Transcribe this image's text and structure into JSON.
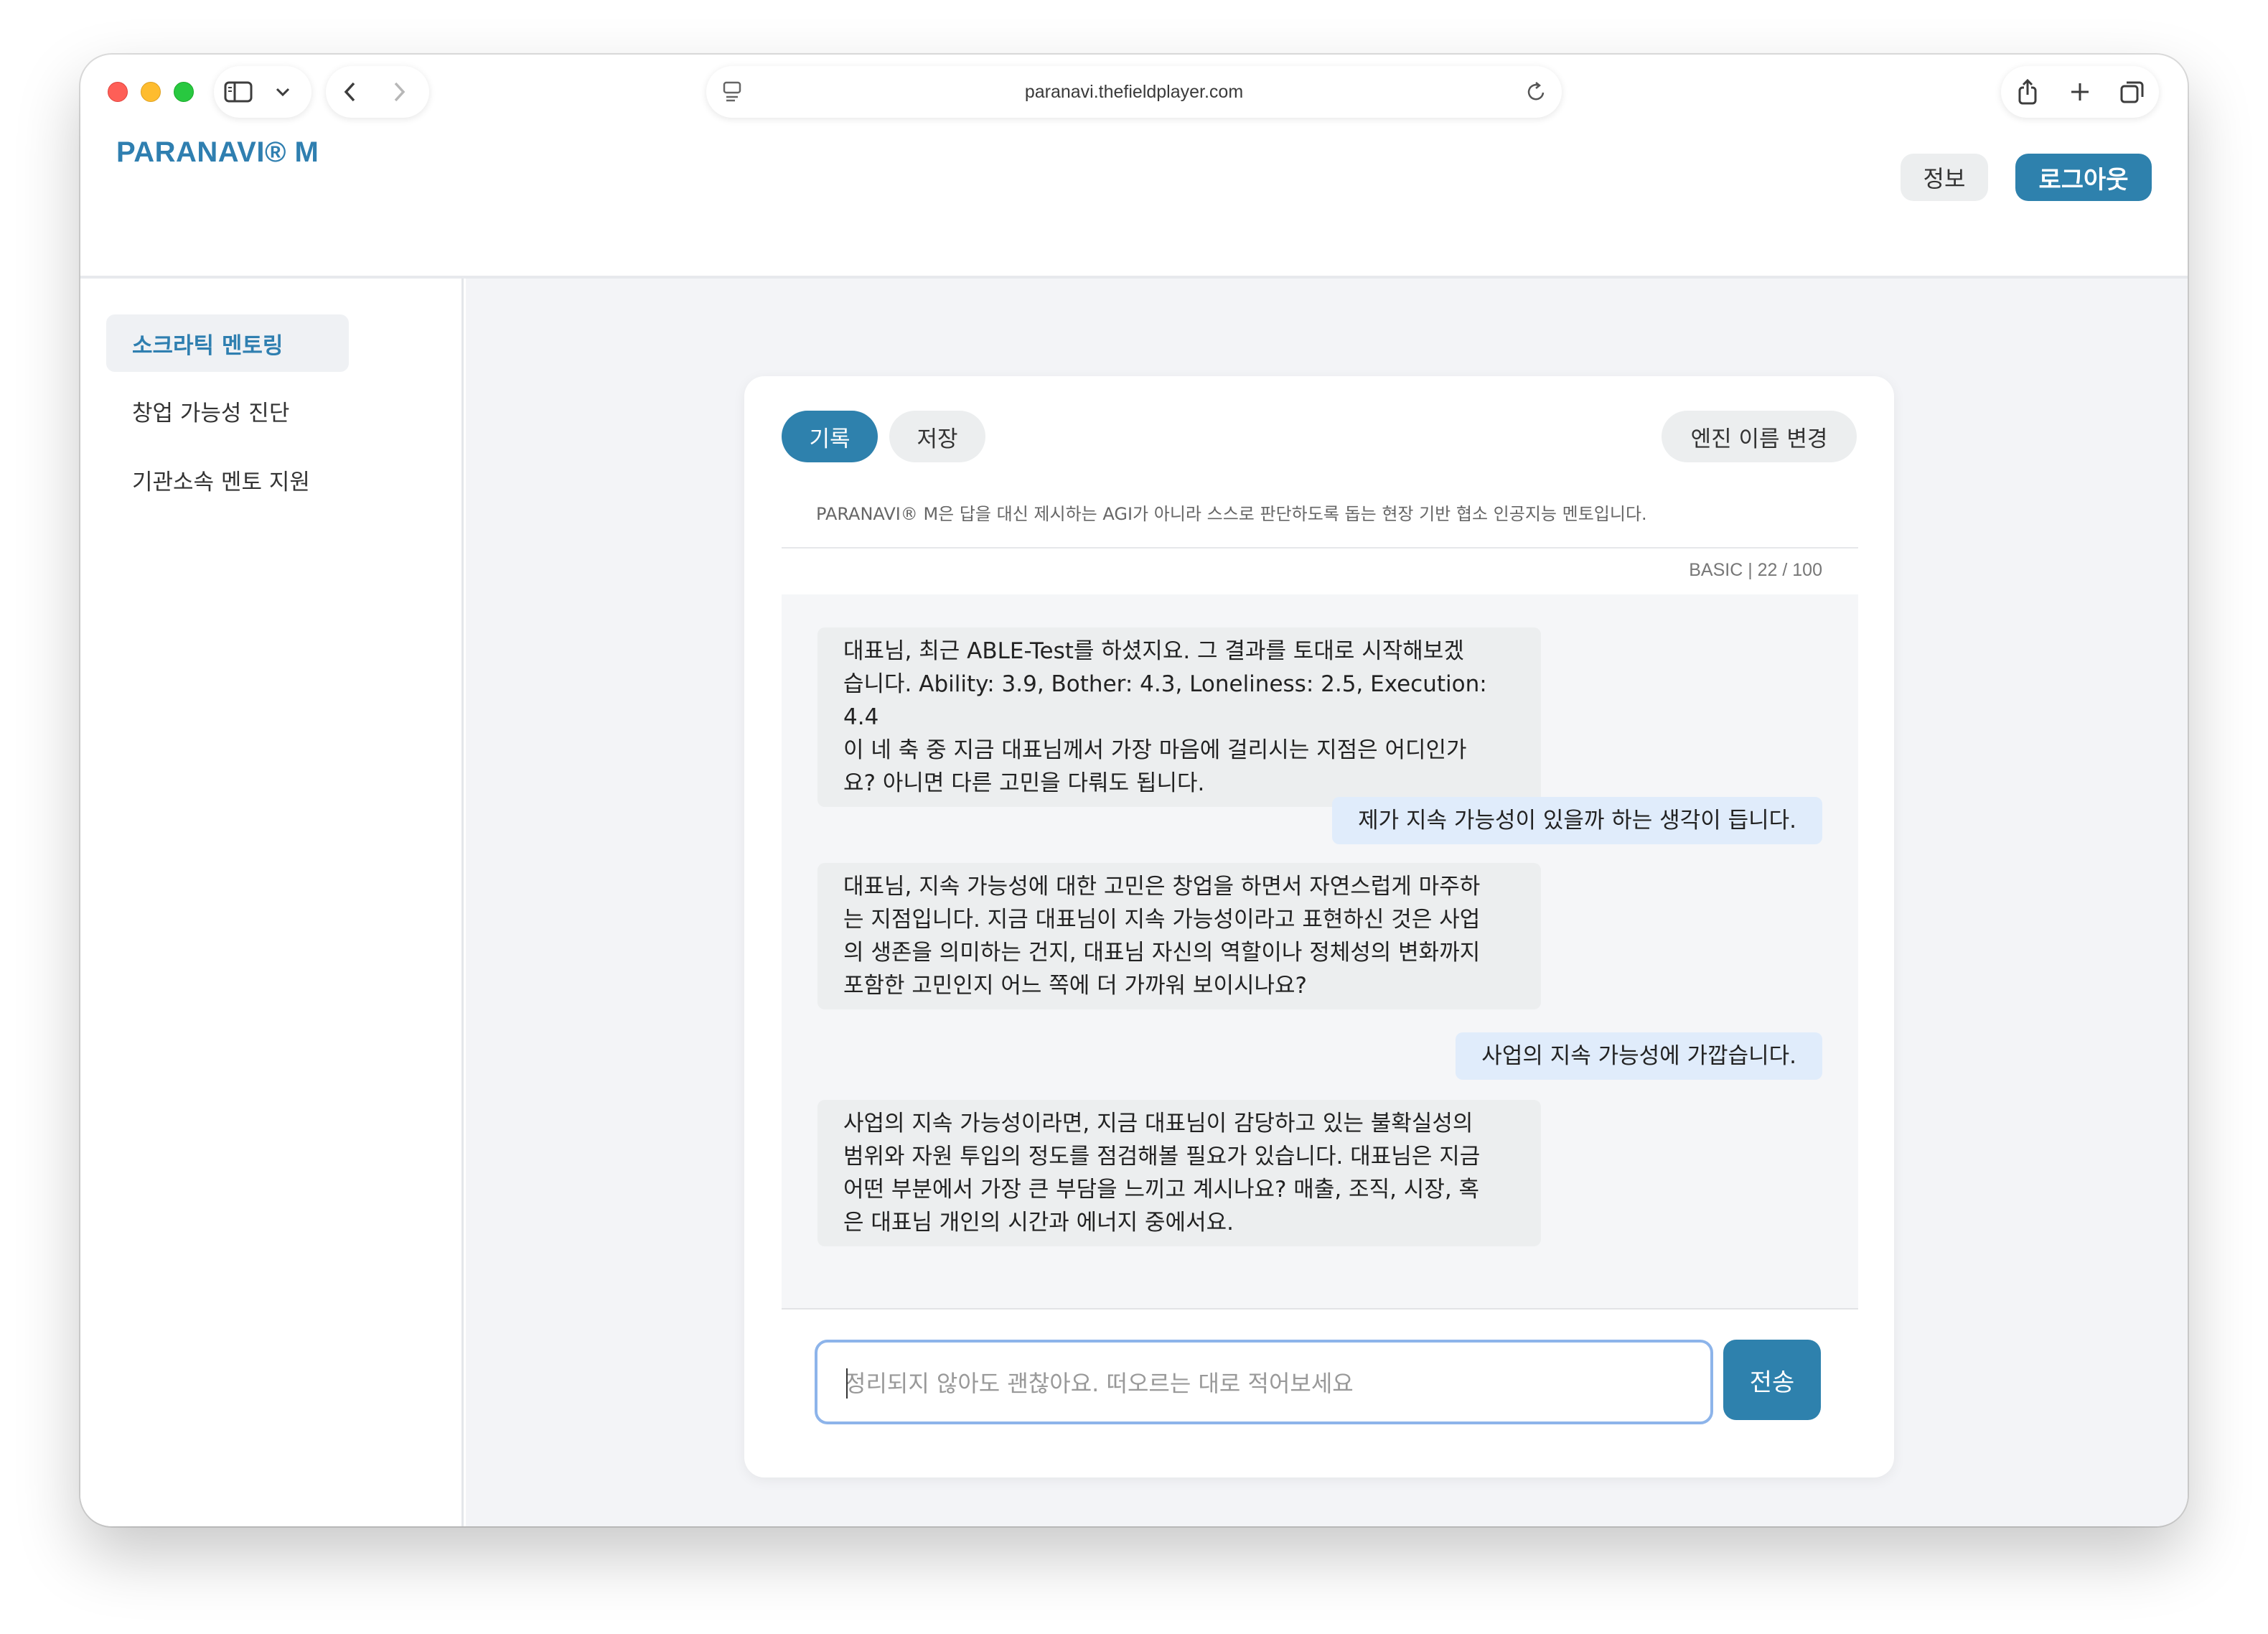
{
  "browser": {
    "url": "paranavi.thefieldplayer.com"
  },
  "header": {
    "brand": "PARANAVI® M",
    "info_label": "정보",
    "logout_label": "로그아웃"
  },
  "sidebar": {
    "items": [
      {
        "label": "소크라틱 멘토링",
        "active": true
      },
      {
        "label": "창업 가능성 진단",
        "active": false
      },
      {
        "label": "기관소속 멘토 지원",
        "active": false
      }
    ]
  },
  "card": {
    "tabs": {
      "record": "기록",
      "save": "저장",
      "rename": "엔진 이름 변경"
    },
    "description": "PARANAVI® M은 답을 대신 제시하는 AGI가 아니라 스스로 판단하도록 돕는 현장 기반 협소 인공지능 멘토입니다.",
    "quota": "BASIC | 22 / 100"
  },
  "chat": {
    "messages": [
      {
        "role": "bot",
        "lines": [
          "대표님, 최근 ABLE-Test를 하셨지요. 그 결과를 토대로 시작해보겠",
          "습니다. Ability: 3.9, Bother: 4.3, Loneliness: 2.5, Execution: 4.4",
          "이 네 축 중 지금 대표님께서 가장 마음에 걸리시는 지점은 어디인가",
          "요? 아니면 다른 고민을 다뤄도 됩니다."
        ]
      },
      {
        "role": "user",
        "lines": [
          "제가 지속 가능성이 있을까 하는 생각이 듭니다."
        ]
      },
      {
        "role": "bot",
        "lines": [
          "대표님, 지속 가능성에 대한 고민은 창업을 하면서 자연스럽게 마주하",
          "는 지점입니다. 지금 대표님이 지속 가능성이라고 표현하신 것은 사업",
          "의 생존을 의미하는 건지, 대표님 자신의 역할이나 정체성의 변화까지",
          "포함한 고민인지 어느 쪽에 더 가까워 보이시나요?"
        ]
      },
      {
        "role": "user",
        "lines": [
          "사업의 지속 가능성에 가깝습니다."
        ]
      },
      {
        "role": "bot",
        "lines": [
          "사업의 지속 가능성이라면, 지금 대표님이 감당하고 있는 불확실성의",
          "범위와 자원 투입의 정도를 점검해볼 필요가 있습니다. 대표님은 지금",
          "어떤 부분에서 가장 큰 부담을 느끼고 계시나요? 매출, 조직, 시장, 혹",
          "은 대표님 개인의 시간과 에너지 중에서요."
        ]
      }
    ]
  },
  "composer": {
    "placeholder": "정리되지 않아도 괜찮아요. 떠오르는 대로 적어보세요",
    "send_label": "전송"
  },
  "colors": {
    "brand": "#2f7fb0",
    "primary_button": "#2e81ad",
    "user_bubble": "#e0ecfb",
    "bot_bubble": "#eceeef"
  }
}
